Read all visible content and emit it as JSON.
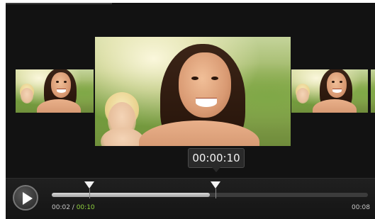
{
  "player": {
    "tooltip_time": "00:00:10",
    "start_time": "00:02",
    "separator": " / ",
    "current_time": "00:10",
    "end_time": "00:08",
    "play_icon": "play-icon",
    "progress_fraction": 0.5
  },
  "colors": {
    "background": "#121212",
    "current_time": "#8fd13f",
    "marker": "#f2f2f2"
  },
  "thumbnails": [
    {
      "name": "thumbnail-left",
      "icon": "photo-thumbnail"
    },
    {
      "name": "thumbnail-center",
      "icon": "photo-thumbnail"
    },
    {
      "name": "thumbnail-right",
      "icon": "photo-thumbnail"
    }
  ]
}
